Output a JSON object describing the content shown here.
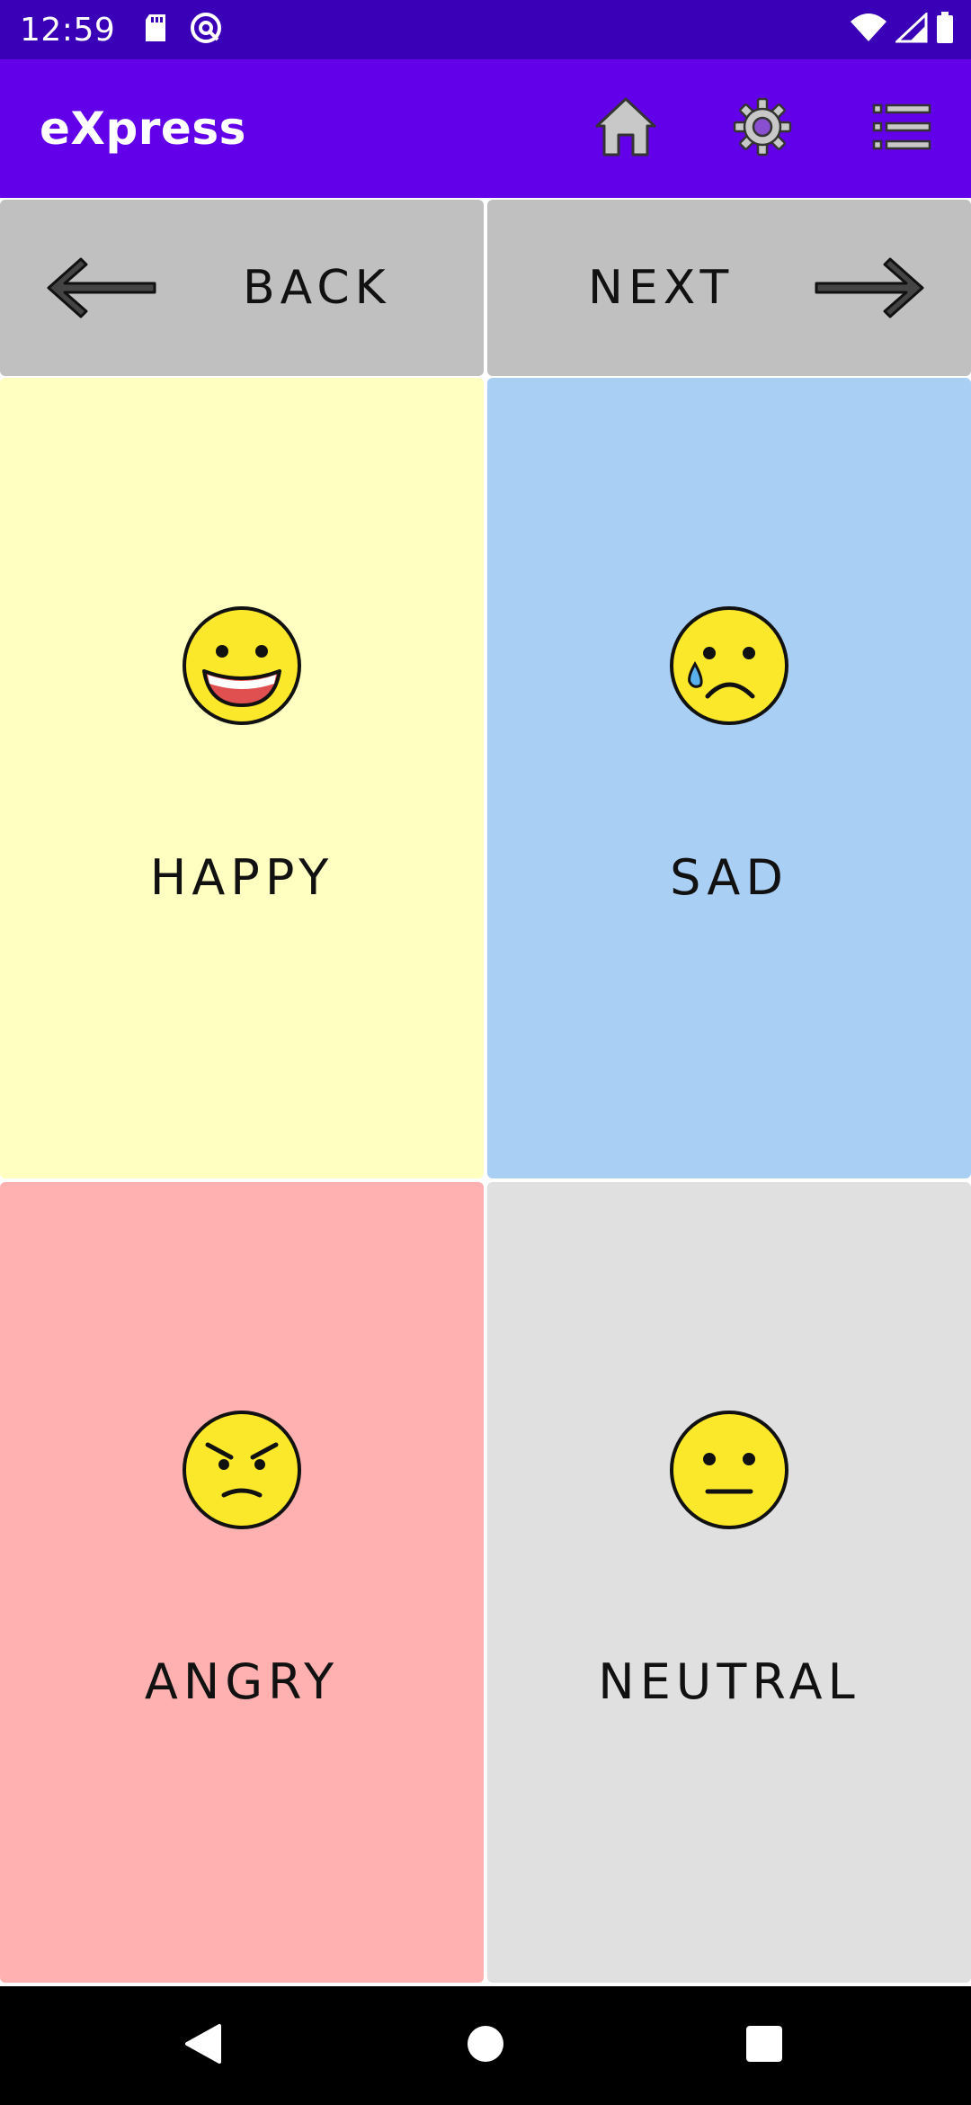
{
  "status_bar": {
    "time": "12:59",
    "icons": [
      "sd-card-icon",
      "at-sign-icon",
      "wifi-icon",
      "signal-icon",
      "battery-icon"
    ]
  },
  "app_bar": {
    "title": "eXpress",
    "actions": [
      "home-icon",
      "gear-icon",
      "list-icon"
    ]
  },
  "navigation": {
    "back_label": "BACK",
    "next_label": "NEXT"
  },
  "emotions": [
    {
      "label": "HAPPY",
      "color": "#ffffc2",
      "icon": "happy-face-icon"
    },
    {
      "label": "SAD",
      "color": "#aacff5",
      "icon": "sad-face-icon"
    },
    {
      "label": "ANGRY",
      "color": "#ffb0b0",
      "icon": "angry-face-icon"
    },
    {
      "label": "NEUTRAL",
      "color": "#e0e0e0",
      "icon": "neutral-face-icon"
    }
  ],
  "colors": {
    "status_bar": "#3a00b8",
    "app_bar": "#6200ea",
    "nav_buttons": "#c0c0c0",
    "emoji_yellow": "#fce82a"
  },
  "system_nav": [
    "back-triangle-icon",
    "home-circle-icon",
    "recents-square-icon"
  ]
}
